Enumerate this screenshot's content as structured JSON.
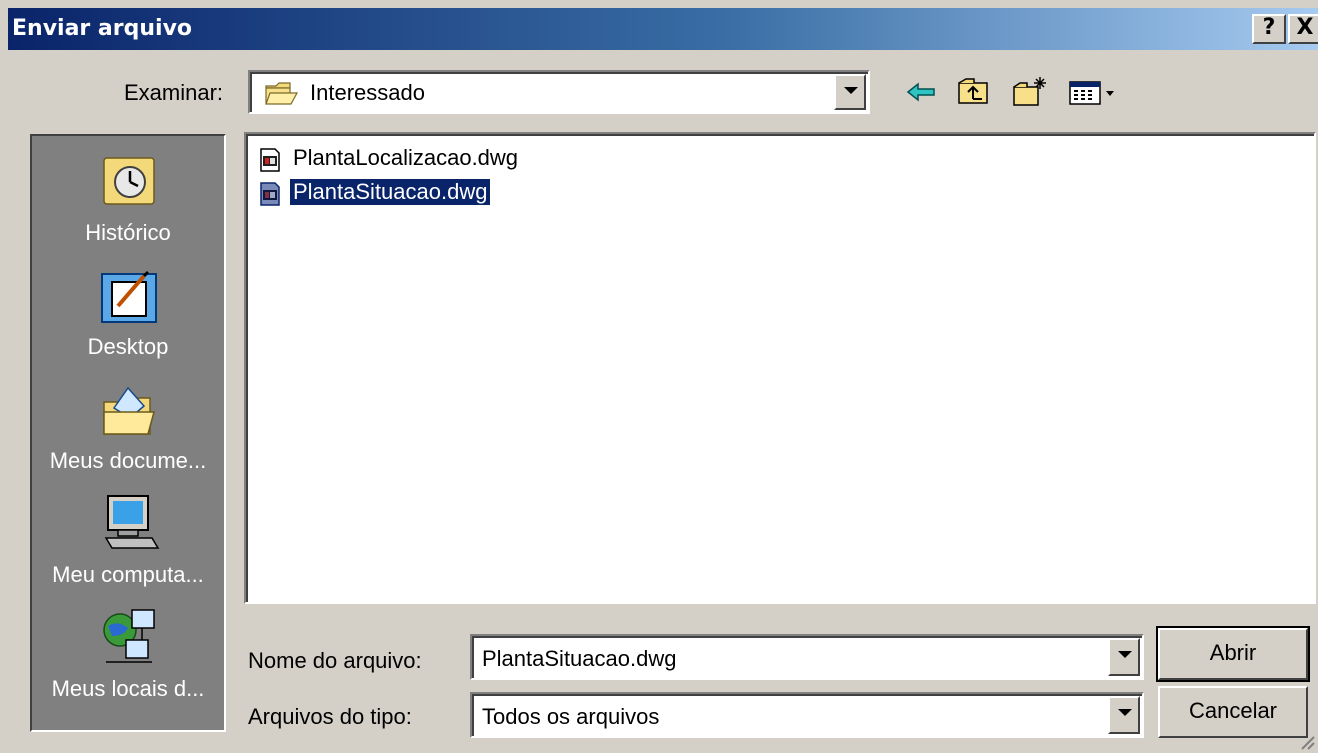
{
  "dialog": {
    "title": "Enviar arquivo",
    "help_label": "?",
    "close_label": "X"
  },
  "look_in": {
    "label": "Examinar:",
    "value": "Interessado",
    "icon": "folder-icon"
  },
  "toolbar": {
    "icons": [
      "back-arrow-icon",
      "up-folder-icon",
      "new-folder-icon",
      "view-menu-icon"
    ]
  },
  "places": [
    {
      "label": "Histórico",
      "icon": "history-icon"
    },
    {
      "label": "Desktop",
      "icon": "desktop-icon"
    },
    {
      "label": "Meus docume...",
      "icon": "my-documents-icon"
    },
    {
      "label": "Meu computa...",
      "icon": "my-computer-icon"
    },
    {
      "label": "Meus locais d...",
      "icon": "network-places-icon"
    }
  ],
  "files": [
    {
      "name": "PlantaLocalizacao.dwg",
      "selected": false
    },
    {
      "name": "PlantaSituacao.dwg",
      "selected": true
    }
  ],
  "filename": {
    "label": "Nome do arquivo:",
    "value": "PlantaSituacao.dwg"
  },
  "filetype": {
    "label": "Arquivos do tipo:",
    "value": "Todos os arquivos"
  },
  "buttons": {
    "open": "Abrir",
    "cancel": "Cancelar"
  },
  "colors": {
    "title_gradient_start": "#0a246a",
    "selection": "#0a246a",
    "face": "#d4d0c8",
    "places_bg": "#808080"
  }
}
